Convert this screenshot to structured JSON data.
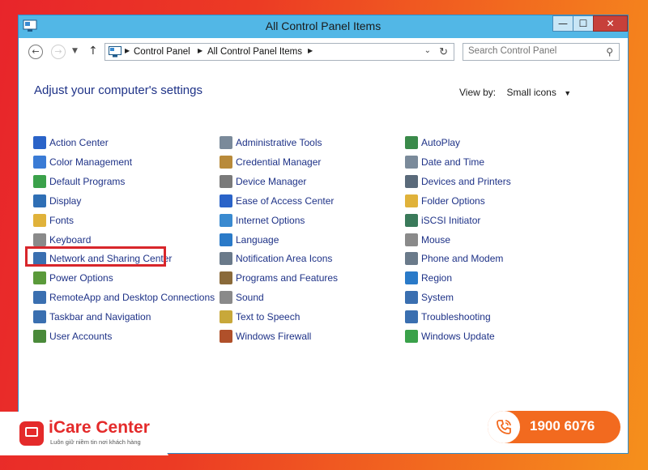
{
  "window": {
    "title": "All Control Panel Items",
    "min_glyph": "—",
    "max_glyph": "☐",
    "close_glyph": "✕"
  },
  "nav": {
    "breadcrumbs": [
      "Control Panel",
      "All Control Panel Items"
    ],
    "search_placeholder": "Search Control Panel"
  },
  "content": {
    "heading": "Adjust your computer's settings",
    "view_by_label": "View by:",
    "view_by_value": "Small icons",
    "columns": [
      [
        {
          "label": "Action Center",
          "icon": "flag-icon",
          "color": "#2a63c8"
        },
        {
          "label": "Color Management",
          "icon": "monitor-color-icon",
          "color": "#3a7bd5"
        },
        {
          "label": "Default Programs",
          "icon": "default-programs-icon",
          "color": "#3aa14a"
        },
        {
          "label": "Display",
          "icon": "display-icon",
          "color": "#2f6fb5"
        },
        {
          "label": "Fonts",
          "icon": "fonts-folder-icon",
          "color": "#e0b23a"
        },
        {
          "label": "Keyboard",
          "icon": "keyboard-icon",
          "color": "#8a8a8a"
        },
        {
          "label": "Network and Sharing Center",
          "icon": "network-icon",
          "color": "#3a6fb0"
        },
        {
          "label": "Power Options",
          "icon": "power-options-icon",
          "color": "#5a9a3a"
        },
        {
          "label": "RemoteApp and Desktop Connections",
          "icon": "remote-desktop-icon",
          "color": "#3a6fb0"
        },
        {
          "label": "Taskbar and Navigation",
          "icon": "taskbar-icon",
          "color": "#3a6fb0"
        },
        {
          "label": "User Accounts",
          "icon": "users-icon",
          "color": "#4a8a3a"
        }
      ],
      [
        {
          "label": "Administrative Tools",
          "icon": "admin-tools-icon",
          "color": "#7a8a9a"
        },
        {
          "label": "Credential Manager",
          "icon": "credential-icon",
          "color": "#b88a3a"
        },
        {
          "label": "Device Manager",
          "icon": "device-manager-icon",
          "color": "#7a7a7a"
        },
        {
          "label": "Ease of Access Center",
          "icon": "ease-of-access-icon",
          "color": "#2a63c8"
        },
        {
          "label": "Internet Options",
          "icon": "internet-icon",
          "color": "#3a8ad0"
        },
        {
          "label": "Language",
          "icon": "language-icon",
          "color": "#2a7ac8"
        },
        {
          "label": "Notification Area Icons",
          "icon": "notification-icon",
          "color": "#6a7a8a"
        },
        {
          "label": "Programs and Features",
          "icon": "programs-icon",
          "color": "#8a6a3a"
        },
        {
          "label": "Sound",
          "icon": "sound-icon",
          "color": "#8a8a8a"
        },
        {
          "label": "Text to Speech",
          "icon": "speech-icon",
          "color": "#c8a83a"
        },
        {
          "label": "Windows Firewall",
          "icon": "firewall-icon",
          "color": "#b0502a"
        }
      ],
      [
        {
          "label": "AutoPlay",
          "icon": "autoplay-icon",
          "color": "#3a8a4a"
        },
        {
          "label": "Date and Time",
          "icon": "clock-icon",
          "color": "#7a8a9a"
        },
        {
          "label": "Devices and Printers",
          "icon": "printer-icon",
          "color": "#5a6a7a"
        },
        {
          "label": "Folder Options",
          "icon": "folder-icon",
          "color": "#e0b23a"
        },
        {
          "label": "iSCSI Initiator",
          "icon": "iscsi-icon",
          "color": "#3a7a5a"
        },
        {
          "label": "Mouse",
          "icon": "mouse-icon",
          "color": "#8a8a8a"
        },
        {
          "label": "Phone and Modem",
          "icon": "phone-modem-icon",
          "color": "#6a7a8a"
        },
        {
          "label": "Region",
          "icon": "globe-icon",
          "color": "#2a7ac8"
        },
        {
          "label": "System",
          "icon": "system-icon",
          "color": "#3a6fb0"
        },
        {
          "label": "Troubleshooting",
          "icon": "troubleshoot-icon",
          "color": "#3a6fb0"
        },
        {
          "label": "Windows Update",
          "icon": "windows-update-icon",
          "color": "#3aa14a"
        }
      ]
    ],
    "highlighted_item": "Network and Sharing Center"
  },
  "branding": {
    "name": "iCare Center",
    "tagline": "Luôn giữ niềm tin nơi khách hàng",
    "phone": "1900 6076",
    "accent": "#e42a2a"
  }
}
